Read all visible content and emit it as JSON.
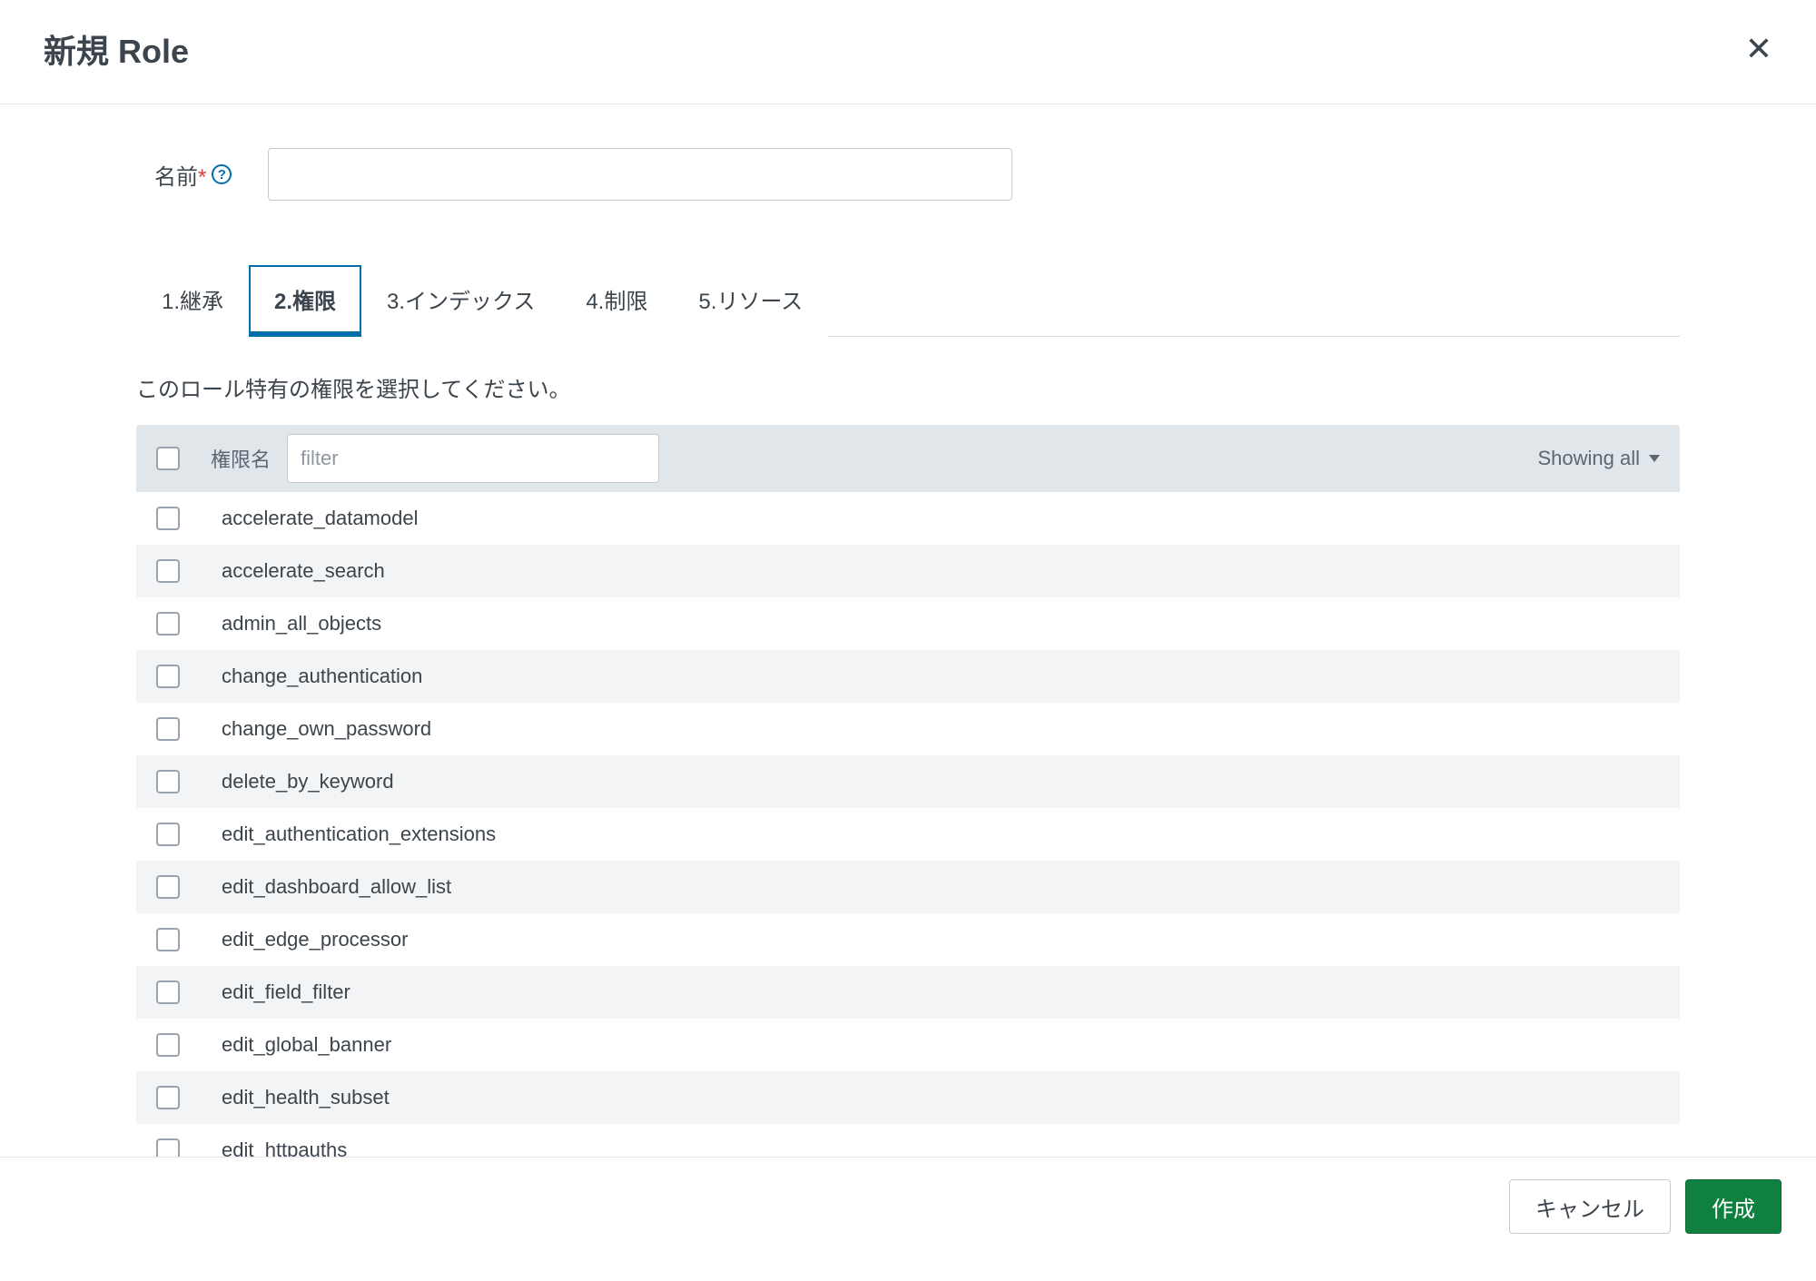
{
  "header": {
    "title": "新規 Role"
  },
  "form": {
    "name_label": "名前",
    "name_value": ""
  },
  "tabs": [
    {
      "label": "1.継承",
      "active": false
    },
    {
      "label": "2.権限",
      "active": true
    },
    {
      "label": "3.インデックス",
      "active": false
    },
    {
      "label": "4.制限",
      "active": false
    },
    {
      "label": "5.リソース",
      "active": false
    }
  ],
  "description": "このロール特有の権限を選択してください。",
  "table": {
    "column_label": "権限名",
    "filter_placeholder": "filter",
    "showing_label": "Showing all",
    "rows": [
      "accelerate_datamodel",
      "accelerate_search",
      "admin_all_objects",
      "change_authentication",
      "change_own_password",
      "delete_by_keyword",
      "edit_authentication_extensions",
      "edit_dashboard_allow_list",
      "edit_edge_processor",
      "edit_field_filter",
      "edit_global_banner",
      "edit_health_subset",
      "edit_httpauths"
    ]
  },
  "footer": {
    "cancel": "キャンセル",
    "create": "作成"
  }
}
